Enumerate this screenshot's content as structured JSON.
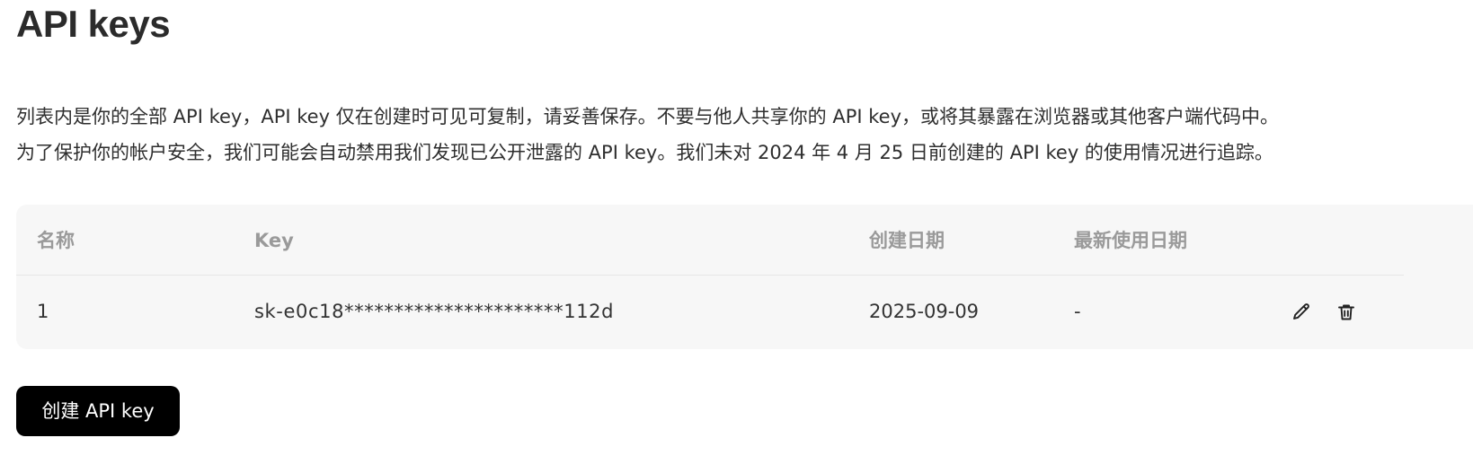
{
  "page": {
    "title": "API keys",
    "description": [
      "列表内是你的全部 API key，API key 仅在创建时可见可复制，请妥善保存。不要与他人共享你的 API key，或将其暴露在浏览器或其他客户端代码中。",
      "为了保护你的帐户安全，我们可能会自动禁用我们发现已公开泄露的 API key。我们未对 2024 年 4 月 25 日前创建的 API key 的使用情况进行追踪。"
    ]
  },
  "table": {
    "headers": {
      "name": "名称",
      "key": "Key",
      "created": "创建日期",
      "last_used": "最新使用日期"
    },
    "rows": [
      {
        "name": "1",
        "key": "sk-e0c18**********************112d",
        "created": "2025-09-09",
        "last_used": "-",
        "actions": [
          "pencil-icon",
          "trash-icon"
        ]
      }
    ]
  },
  "actions": {
    "create_label": "创建 API key"
  },
  "colors": {
    "panel_background": "#f7f7f7",
    "header_text": "#9a9a9a",
    "button_background": "#000000",
    "button_text": "#ffffff"
  }
}
